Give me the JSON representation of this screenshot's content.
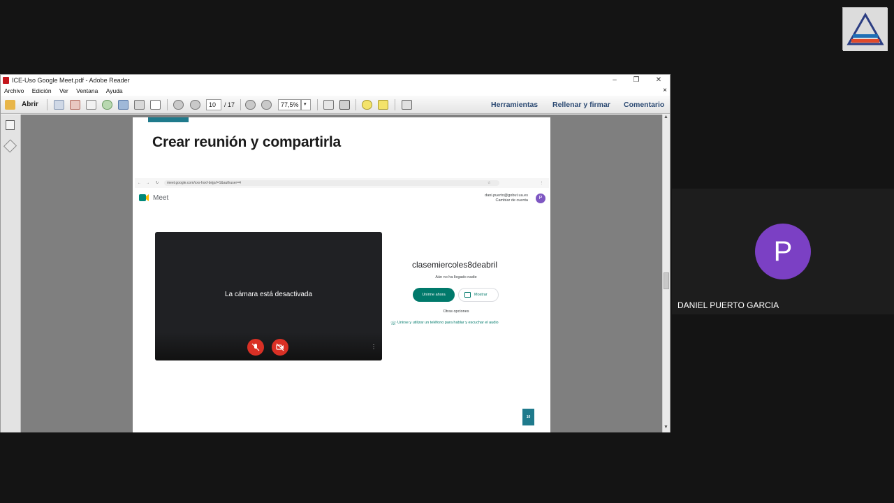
{
  "window": {
    "title": "ICE-Uso Google Meet.pdf - Adobe Reader",
    "buttons": {
      "minimize": "–",
      "restore": "❐",
      "close": "✕"
    }
  },
  "menu": {
    "items": [
      "Archivo",
      "Edición",
      "Ver",
      "Ventana",
      "Ayuda"
    ],
    "close_doc": "×"
  },
  "toolbar": {
    "open_label": "Abrir",
    "page_current": "10",
    "page_total": "/ 17",
    "zoom": "77,5%",
    "right_links": [
      "Herramientas",
      "Rellenar y firmar",
      "Comentario"
    ]
  },
  "pdf": {
    "heading": "Crear reunión y compartirla",
    "page_badge": "10",
    "accent_color": "#1f7a8c"
  },
  "meet": {
    "url": "meet.google.com/xxx-hxxf-bnjp/i=1&authuser=4",
    "brand": "Meet",
    "account_email": "dani.puerto@gobut.ua.es",
    "account_switch": "Cambiar de cuenta",
    "account_initial": "P",
    "camera_off": "La cámara está desactivada",
    "meeting_name": "clasemiercoles8deabril",
    "nobody_here": "Aún no ha llegado nadie",
    "join_label": "Unirme ahora",
    "present_label": "Mostrar",
    "other_options": "Otras opciones",
    "phone_join": "Unirse y utilizar un teléfono para hablar y escuchar el audio",
    "join_color": "#00796b",
    "mic_color": "#d93025"
  },
  "participant": {
    "initial": "P",
    "name": "DANIEL PUERTO GARCIA",
    "avatar_color": "#7b40c4"
  }
}
